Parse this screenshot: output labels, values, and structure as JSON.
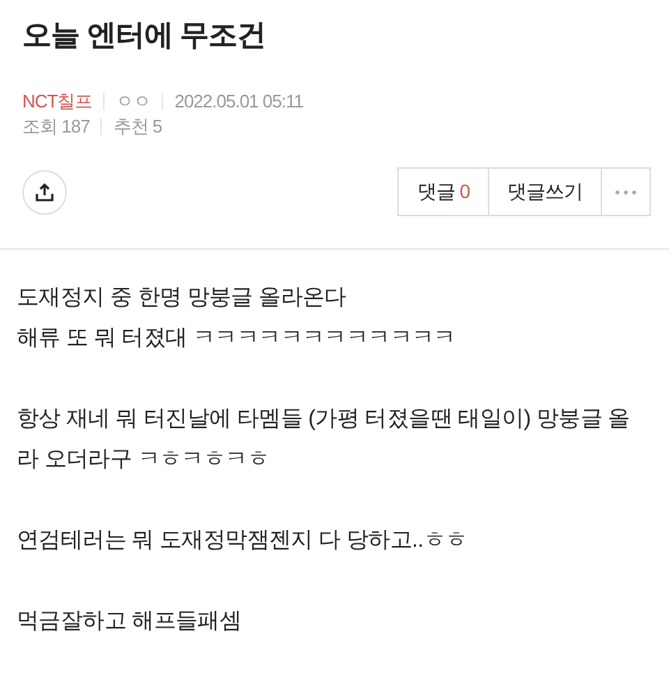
{
  "title": "오늘 엔터에 무조건",
  "meta_row_1": [
    {
      "kind": "author",
      "text": "NCT칠프"
    },
    {
      "kind": "plain",
      "text": "ㅇㅇ"
    },
    {
      "kind": "plain",
      "text": "2022.05.01 05:11"
    }
  ],
  "meta_row_2": [
    {
      "label": "조회",
      "value": "187"
    },
    {
      "label": "추천",
      "value": "5"
    }
  ],
  "comment_button": {
    "label": "댓글",
    "count": "0"
  },
  "write_comment_button": {
    "label": "댓글쓰기"
  },
  "body": [
    [
      "도재정지 중 한명 망붕글 올라온다",
      "해류 또 뭐 터졌대 ㅋㅋㅋㅋㅋㅋㅋㅋㅋㅋㅋㅋ"
    ],
    [
      "항상 재네 뭐 터진날에 타멤들 (가평 터졌을땐 태일이) 망붕글 올라 오더라구 ㅋㅎㅋㅎㅋㅎ"
    ],
    [
      "연검테러는 뭐 도재정막잼젠지 다 당하고..ㅎㅎ"
    ],
    [
      "먹금잘하고 해프들패셈"
    ]
  ]
}
